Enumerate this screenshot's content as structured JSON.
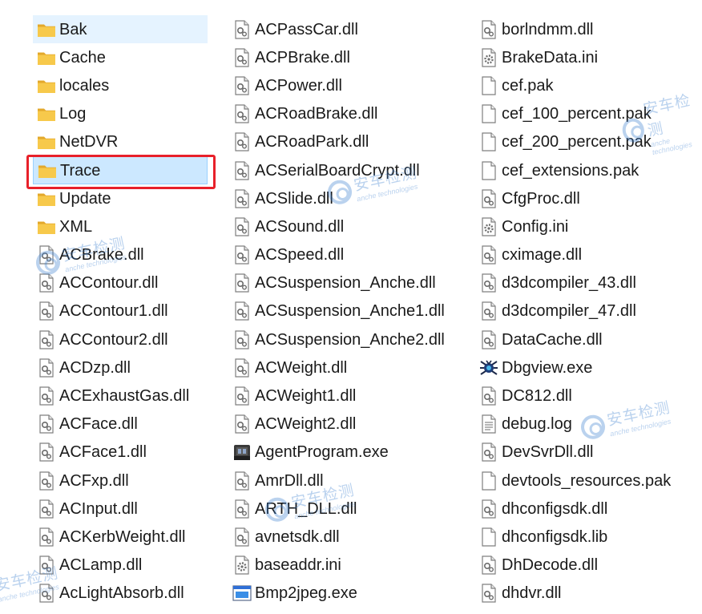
{
  "files": {
    "col1": [
      {
        "label": "Bak",
        "type": "folder",
        "state": "hover"
      },
      {
        "label": "Cache",
        "type": "folder"
      },
      {
        "label": "locales",
        "type": "folder"
      },
      {
        "label": "Log",
        "type": "folder"
      },
      {
        "label": "NetDVR",
        "type": "folder"
      },
      {
        "label": "Trace",
        "type": "folder",
        "state": "selected"
      },
      {
        "label": "Update",
        "type": "folder"
      },
      {
        "label": "XML",
        "type": "folder"
      },
      {
        "label": "ACBrake.dll",
        "type": "dll"
      },
      {
        "label": "ACContour.dll",
        "type": "dll"
      },
      {
        "label": "ACContour1.dll",
        "type": "dll"
      },
      {
        "label": "ACContour2.dll",
        "type": "dll"
      },
      {
        "label": "ACDzp.dll",
        "type": "dll"
      },
      {
        "label": "ACExhaustGas.dll",
        "type": "dll"
      },
      {
        "label": "ACFace.dll",
        "type": "dll"
      },
      {
        "label": "ACFace1.dll",
        "type": "dll"
      },
      {
        "label": "ACFxp.dll",
        "type": "dll"
      },
      {
        "label": "ACInput.dll",
        "type": "dll"
      },
      {
        "label": "ACKerbWeight.dll",
        "type": "dll"
      },
      {
        "label": "ACLamp.dll",
        "type": "dll"
      },
      {
        "label": "AcLightAbsorb.dll",
        "type": "dll"
      }
    ],
    "col2": [
      {
        "label": "ACPassCar.dll",
        "type": "dll"
      },
      {
        "label": "ACPBrake.dll",
        "type": "dll"
      },
      {
        "label": "ACPower.dll",
        "type": "dll"
      },
      {
        "label": "ACRoadBrake.dll",
        "type": "dll"
      },
      {
        "label": "ACRoadPark.dll",
        "type": "dll"
      },
      {
        "label": "ACSerialBoardCrypt.dll",
        "type": "dll"
      },
      {
        "label": "ACSlide.dll",
        "type": "dll"
      },
      {
        "label": "ACSound.dll",
        "type": "dll"
      },
      {
        "label": "ACSpeed.dll",
        "type": "dll"
      },
      {
        "label": "ACSuspension_Anche.dll",
        "type": "dll"
      },
      {
        "label": "ACSuspension_Anche1.dll",
        "type": "dll"
      },
      {
        "label": "ACSuspension_Anche2.dll",
        "type": "dll"
      },
      {
        "label": "ACWeight.dll",
        "type": "dll"
      },
      {
        "label": "ACWeight1.dll",
        "type": "dll"
      },
      {
        "label": "ACWeight2.dll",
        "type": "dll"
      },
      {
        "label": "AgentProgram.exe",
        "type": "exe-agent"
      },
      {
        "label": "AmrDll.dll",
        "type": "dll"
      },
      {
        "label": "ARTH_DLL.dll",
        "type": "dll"
      },
      {
        "label": "avnetsdk.dll",
        "type": "dll"
      },
      {
        "label": "baseaddr.ini",
        "type": "ini"
      },
      {
        "label": "Bmp2jpeg.exe",
        "type": "exe-window"
      }
    ],
    "col3": [
      {
        "label": "borlndmm.dll",
        "type": "dll"
      },
      {
        "label": "BrakeData.ini",
        "type": "ini"
      },
      {
        "label": "cef.pak",
        "type": "file"
      },
      {
        "label": "cef_100_percent.pak",
        "type": "file"
      },
      {
        "label": "cef_200_percent.pak",
        "type": "file"
      },
      {
        "label": "cef_extensions.pak",
        "type": "file"
      },
      {
        "label": "CfgProc.dll",
        "type": "dll"
      },
      {
        "label": "Config.ini",
        "type": "ini"
      },
      {
        "label": "cximage.dll",
        "type": "dll"
      },
      {
        "label": "d3dcompiler_43.dll",
        "type": "dll"
      },
      {
        "label": "d3dcompiler_47.dll",
        "type": "dll"
      },
      {
        "label": "DataCache.dll",
        "type": "dll"
      },
      {
        "label": "Dbgview.exe",
        "type": "exe-bug"
      },
      {
        "label": "DC812.dll",
        "type": "dll"
      },
      {
        "label": "debug.log",
        "type": "text"
      },
      {
        "label": "DevSvrDll.dll",
        "type": "dll"
      },
      {
        "label": "devtools_resources.pak",
        "type": "file"
      },
      {
        "label": "dhconfigsdk.dll",
        "type": "dll"
      },
      {
        "label": "dhconfigsdk.lib",
        "type": "file"
      },
      {
        "label": "DhDecode.dll",
        "type": "dll"
      },
      {
        "label": "dhdvr.dll",
        "type": "dll"
      }
    ]
  },
  "watermark": {
    "text": "安车检测",
    "subtext": "anche technologies",
    "color": "#3b7fd0"
  },
  "colors": {
    "hover_bg": "#e5f3ff",
    "selected_bg": "#cce8ff",
    "highlight_border": "#e8202a",
    "folder": "#f7c94b"
  }
}
